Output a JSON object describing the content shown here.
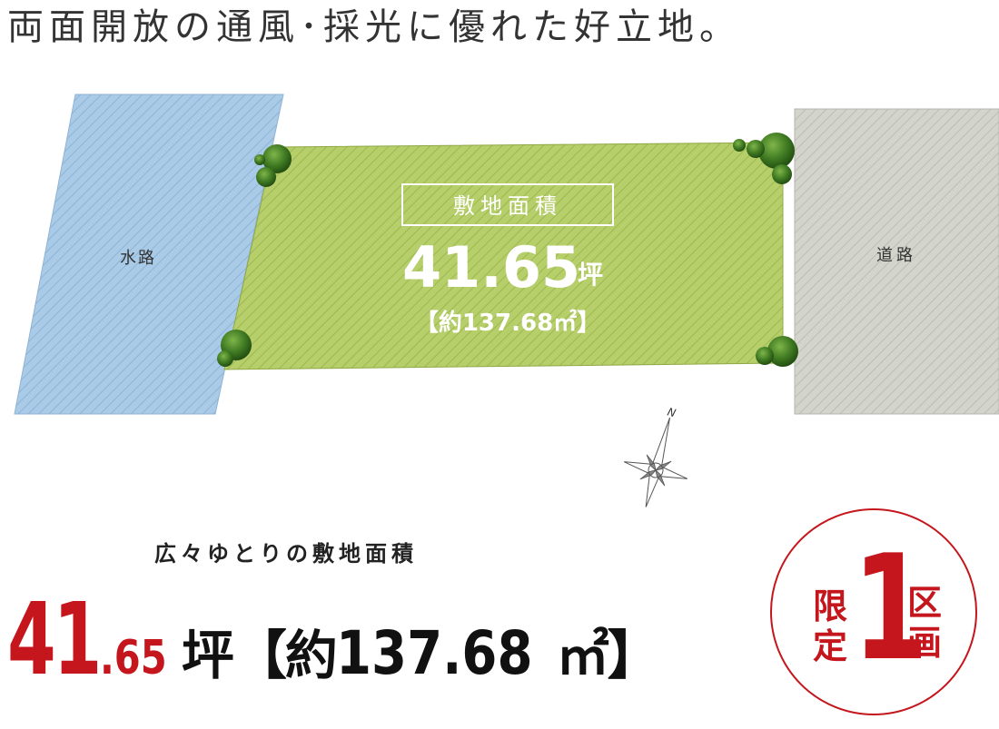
{
  "headline": "両面開放の通風･採光に優れた好立地。",
  "map": {
    "waterway_label": "水路",
    "road_label": "道路",
    "area_title": "敷地面積",
    "area_value": "41.65",
    "area_unit": "坪",
    "area_sqm": "【約137.68㎡】",
    "compass_north": "N",
    "colors": {
      "waterway": "#a9cbe8",
      "lot": "#b6cf6a",
      "road": "#d3d5cc"
    }
  },
  "summary": {
    "subtitle": "広々ゆとりの敷地面積",
    "value_int": "41",
    "value_dec": ".65",
    "unit": "坪",
    "sqm_open": "【約",
    "sqm_value": "137.68",
    "sqm_unit": "㎡",
    "sqm_close": "】",
    "accent_color": "#c4161c"
  },
  "badge": {
    "left_text": "限定",
    "number": "1",
    "right_text": "区画"
  }
}
